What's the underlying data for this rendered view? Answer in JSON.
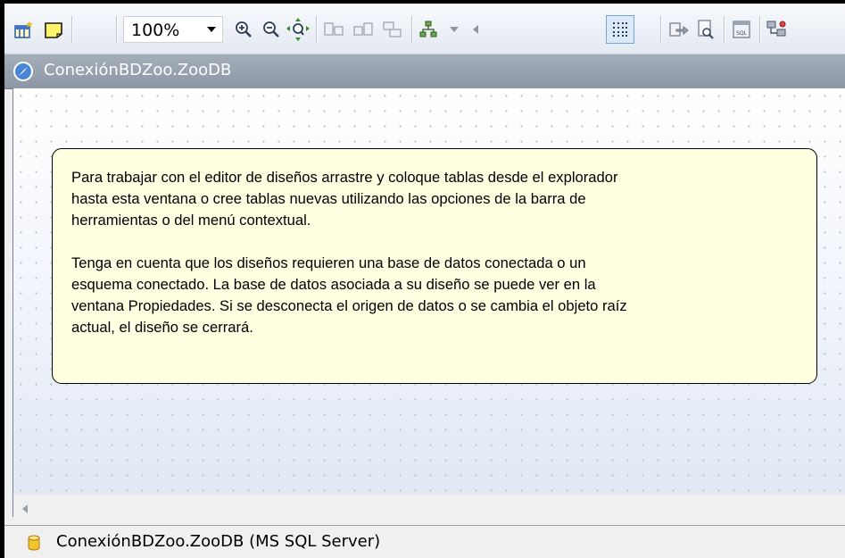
{
  "toolbar": {
    "zoom_value": "100%",
    "icons": [
      "insert-table-icon",
      "add-note-icon",
      "zoom-dropdown-arrow-icon",
      "zoom-in-icon",
      "zoom-out-icon",
      "zoom-to-fit-icon",
      "layout-icon-1",
      "layout-icon-2",
      "layout-icon-3",
      "hierarchical-layout-icon",
      "dropdown-arrow-icon",
      "collapse-arrow-icon",
      "show-grid-icon",
      "export-icon",
      "print-preview-icon",
      "sql-icon",
      "connect-icon"
    ]
  },
  "title_bar": {
    "icon": "database-connection-icon",
    "title": "ConexiónBDZoo.ZooDB"
  },
  "note": {
    "paragraph1_lines": [
      "Para trabajar con el editor de diseños arrastre y coloque tablas desde el explorador",
      "hasta esta ventana o cree tablas nuevas utilizando las opciones de la barra de",
      "herramientas o del menú contextual."
    ],
    "paragraph2_lines": [
      "Tenga en cuenta que los diseños requieren una base de datos conectada o un",
      "esquema conectado. La base de datos asociada a su diseño se puede ver en la",
      "ventana Propiedades. Si se desconecta el origen de datos o se cambia el objeto raíz",
      "actual, el diseño se cerrará."
    ]
  },
  "status_bar": {
    "icon": "database-icon",
    "text": "ConexiónBDZoo.ZooDB (MS SQL Server)"
  },
  "colors": {
    "note_background": "#ffffe1",
    "title_bar": "#9aa3b0",
    "grid_selected": "#dbe9fb",
    "database_icon": "#f2c230"
  }
}
